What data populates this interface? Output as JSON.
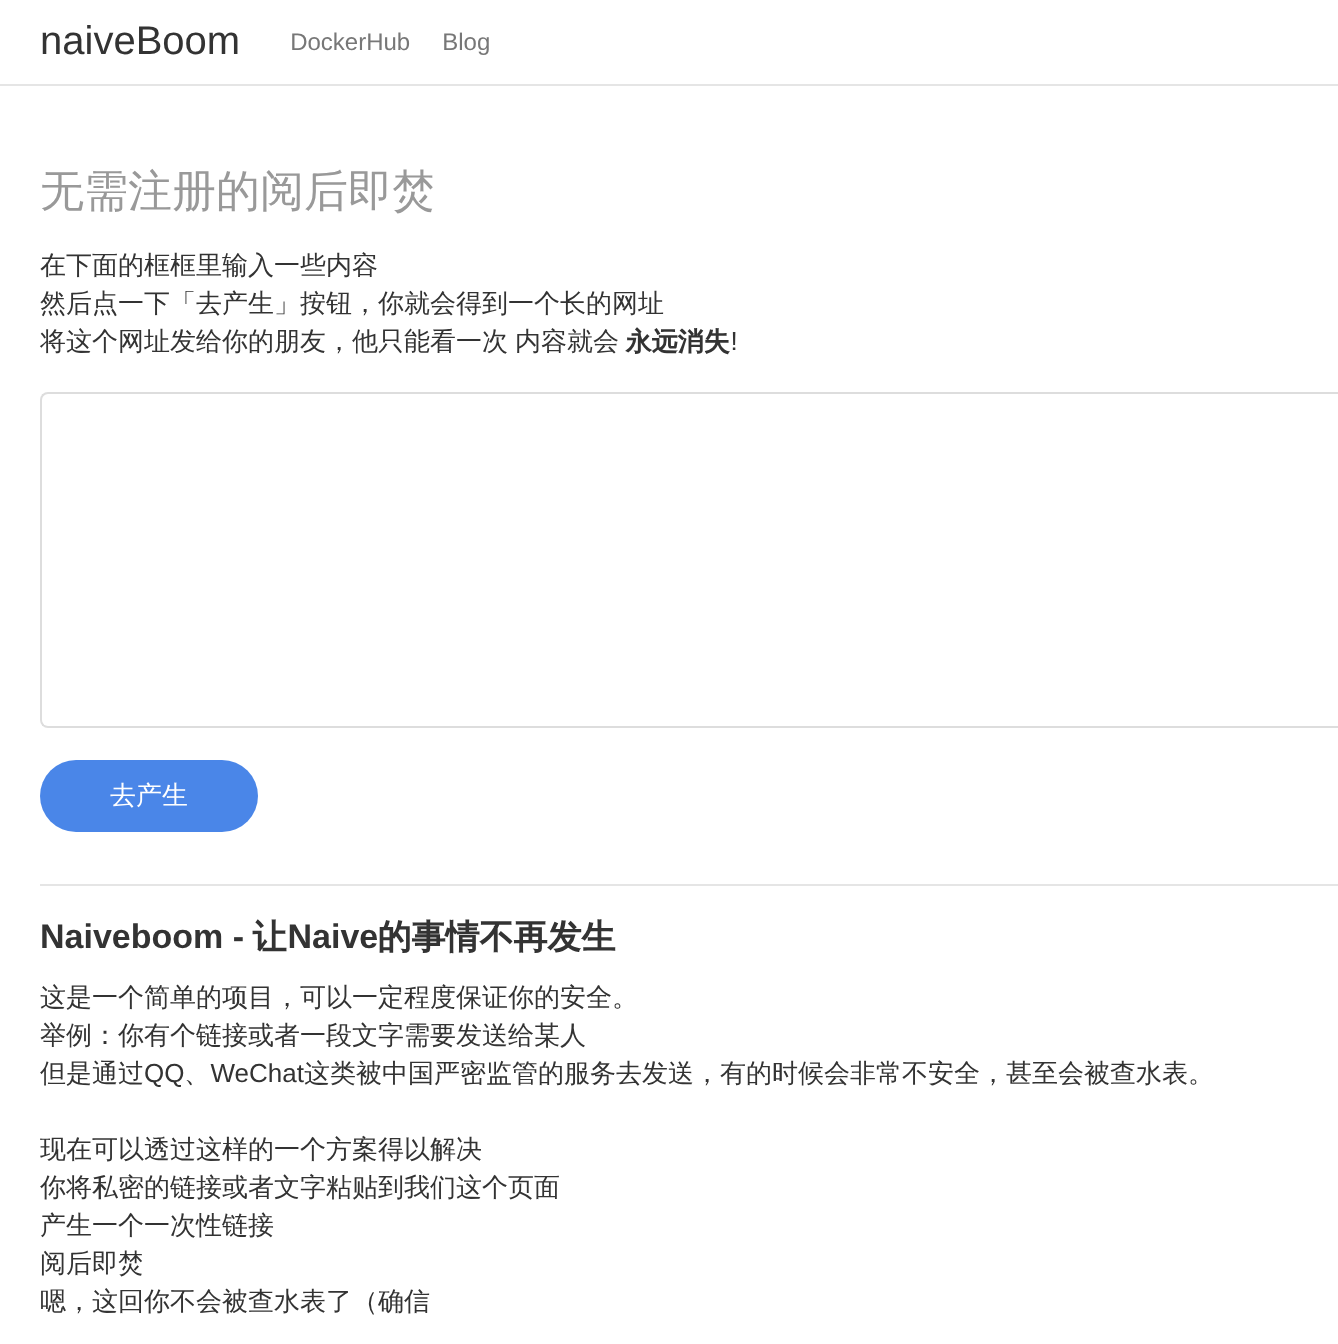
{
  "navbar": {
    "brand": "naiveBoom",
    "links": [
      {
        "label": "DockerHub"
      },
      {
        "label": "Blog"
      }
    ]
  },
  "heading": "无需注册的阅后即焚",
  "intro": [
    "在下面的框框里输入一些内容",
    "然后点一下「去产生」按钮，你就会得到一个长的网址",
    "将这个网址发给你的朋友，他只能看一次 内容就会 **永远消失**!"
  ],
  "submit_button": "去产生",
  "about": {
    "title": "Naiveboom - 让Naive的事情不再发生",
    "paragraphs": [
      [
        "这是一个简单的项目，可以一定程度保证你的安全。",
        "举例：你有个链接或者一段文字需要发送给某人",
        "但是通过QQ、WeChat这类被中国严密监管的服务去发送，有的时候会非常不安全，甚至会被查水表。"
      ],
      [
        "现在可以透过这样的一个方案得以解决",
        "你将私密的链接或者文字粘贴到我们这个页面",
        "产生一个一次性链接",
        "阅后即焚",
        "嗯，这回你不会被查水表了（确信"
      ]
    ]
  }
}
